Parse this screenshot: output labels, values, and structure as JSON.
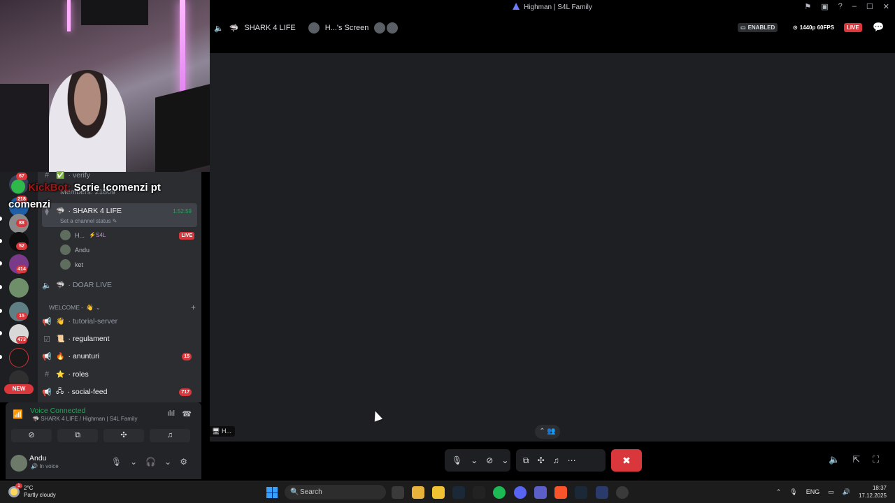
{
  "window": {
    "title": "Highman | S4L Family"
  },
  "stream_header": {
    "channel": "SHARK 4 LIFE",
    "screen_label": "H...'s Screen",
    "enabled_label": "ENABLED",
    "quality": "1440p 60FPS",
    "live": "LIVE"
  },
  "stage": {
    "tile_label": "H..."
  },
  "overlay": {
    "bot_name": "KickBot:",
    "message": "Scrie !comenzi pt comenzi"
  },
  "servers": [
    {
      "badge": "67"
    },
    {
      "badge": "218"
    },
    {
      "badge": "88"
    },
    {
      "badge": "52"
    },
    {
      "badge": "414"
    },
    {
      "badge": ""
    },
    {
      "badge": "15"
    },
    {
      "badge": "473"
    },
    {
      "badge": ""
    },
    {
      "badge": ""
    }
  ],
  "new_label": "NEW",
  "channels": {
    "verify": "verify",
    "members": "Members: 21809",
    "voice_active": {
      "name": "SHARK 4 LIFE",
      "timer": "1:52:59",
      "status": "Set a channel status"
    },
    "voice_users": [
      {
        "name": "H...",
        "tag": "S4L",
        "live": "LIVE"
      },
      {
        "name": "Andu"
      },
      {
        "name": "ket"
      }
    ],
    "doar_live": "DOAR LIVE",
    "category": "WELCOME -",
    "list": [
      {
        "name": "tutorial-server",
        "badge": ""
      },
      {
        "name": "regulament",
        "badge": ""
      },
      {
        "name": "anunturi",
        "badge": "15"
      },
      {
        "name": "roles",
        "badge": ""
      },
      {
        "name": "social-feed",
        "badge": "717"
      }
    ]
  },
  "voice_panel": {
    "title": "Voice Connected",
    "subtitle": "SHARK 4 LIFE / Highman | S4L Family"
  },
  "user_panel": {
    "name": "Andu",
    "status": "In voice"
  },
  "taskbar": {
    "weather_temp": "2°C",
    "weather_desc": "Partly cloudy",
    "weather_badge": "1",
    "search_placeholder": "Search",
    "language": "ENG",
    "time": "18:37",
    "date": "17.12.2025"
  }
}
